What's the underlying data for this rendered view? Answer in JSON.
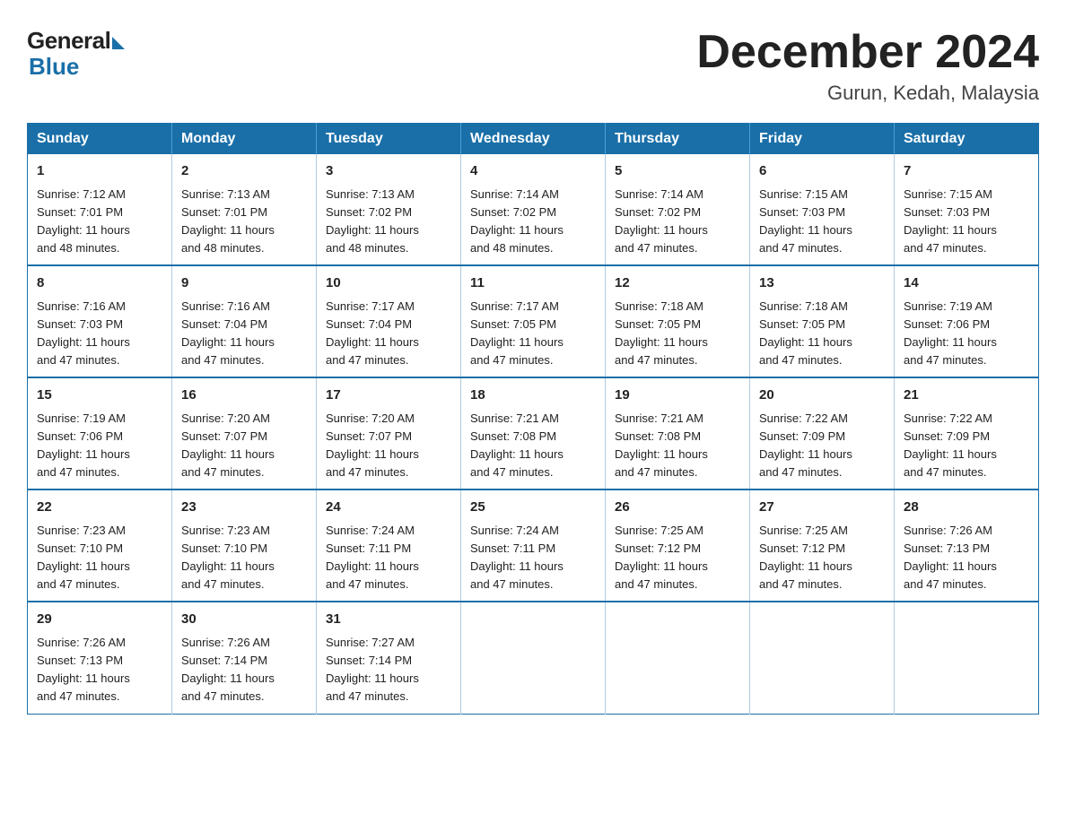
{
  "logo": {
    "general": "General",
    "blue": "Blue"
  },
  "title": {
    "month_year": "December 2024",
    "location": "Gurun, Kedah, Malaysia"
  },
  "weekdays": [
    "Sunday",
    "Monday",
    "Tuesday",
    "Wednesday",
    "Thursday",
    "Friday",
    "Saturday"
  ],
  "weeks": [
    [
      {
        "day": "1",
        "sunrise": "7:12 AM",
        "sunset": "7:01 PM",
        "daylight": "11 hours and 48 minutes."
      },
      {
        "day": "2",
        "sunrise": "7:13 AM",
        "sunset": "7:01 PM",
        "daylight": "11 hours and 48 minutes."
      },
      {
        "day": "3",
        "sunrise": "7:13 AM",
        "sunset": "7:02 PM",
        "daylight": "11 hours and 48 minutes."
      },
      {
        "day": "4",
        "sunrise": "7:14 AM",
        "sunset": "7:02 PM",
        "daylight": "11 hours and 48 minutes."
      },
      {
        "day": "5",
        "sunrise": "7:14 AM",
        "sunset": "7:02 PM",
        "daylight": "11 hours and 47 minutes."
      },
      {
        "day": "6",
        "sunrise": "7:15 AM",
        "sunset": "7:03 PM",
        "daylight": "11 hours and 47 minutes."
      },
      {
        "day": "7",
        "sunrise": "7:15 AM",
        "sunset": "7:03 PM",
        "daylight": "11 hours and 47 minutes."
      }
    ],
    [
      {
        "day": "8",
        "sunrise": "7:16 AM",
        "sunset": "7:03 PM",
        "daylight": "11 hours and 47 minutes."
      },
      {
        "day": "9",
        "sunrise": "7:16 AM",
        "sunset": "7:04 PM",
        "daylight": "11 hours and 47 minutes."
      },
      {
        "day": "10",
        "sunrise": "7:17 AM",
        "sunset": "7:04 PM",
        "daylight": "11 hours and 47 minutes."
      },
      {
        "day": "11",
        "sunrise": "7:17 AM",
        "sunset": "7:05 PM",
        "daylight": "11 hours and 47 minutes."
      },
      {
        "day": "12",
        "sunrise": "7:18 AM",
        "sunset": "7:05 PM",
        "daylight": "11 hours and 47 minutes."
      },
      {
        "day": "13",
        "sunrise": "7:18 AM",
        "sunset": "7:05 PM",
        "daylight": "11 hours and 47 minutes."
      },
      {
        "day": "14",
        "sunrise": "7:19 AM",
        "sunset": "7:06 PM",
        "daylight": "11 hours and 47 minutes."
      }
    ],
    [
      {
        "day": "15",
        "sunrise": "7:19 AM",
        "sunset": "7:06 PM",
        "daylight": "11 hours and 47 minutes."
      },
      {
        "day": "16",
        "sunrise": "7:20 AM",
        "sunset": "7:07 PM",
        "daylight": "11 hours and 47 minutes."
      },
      {
        "day": "17",
        "sunrise": "7:20 AM",
        "sunset": "7:07 PM",
        "daylight": "11 hours and 47 minutes."
      },
      {
        "day": "18",
        "sunrise": "7:21 AM",
        "sunset": "7:08 PM",
        "daylight": "11 hours and 47 minutes."
      },
      {
        "day": "19",
        "sunrise": "7:21 AM",
        "sunset": "7:08 PM",
        "daylight": "11 hours and 47 minutes."
      },
      {
        "day": "20",
        "sunrise": "7:22 AM",
        "sunset": "7:09 PM",
        "daylight": "11 hours and 47 minutes."
      },
      {
        "day": "21",
        "sunrise": "7:22 AM",
        "sunset": "7:09 PM",
        "daylight": "11 hours and 47 minutes."
      }
    ],
    [
      {
        "day": "22",
        "sunrise": "7:23 AM",
        "sunset": "7:10 PM",
        "daylight": "11 hours and 47 minutes."
      },
      {
        "day": "23",
        "sunrise": "7:23 AM",
        "sunset": "7:10 PM",
        "daylight": "11 hours and 47 minutes."
      },
      {
        "day": "24",
        "sunrise": "7:24 AM",
        "sunset": "7:11 PM",
        "daylight": "11 hours and 47 minutes."
      },
      {
        "day": "25",
        "sunrise": "7:24 AM",
        "sunset": "7:11 PM",
        "daylight": "11 hours and 47 minutes."
      },
      {
        "day": "26",
        "sunrise": "7:25 AM",
        "sunset": "7:12 PM",
        "daylight": "11 hours and 47 minutes."
      },
      {
        "day": "27",
        "sunrise": "7:25 AM",
        "sunset": "7:12 PM",
        "daylight": "11 hours and 47 minutes."
      },
      {
        "day": "28",
        "sunrise": "7:26 AM",
        "sunset": "7:13 PM",
        "daylight": "11 hours and 47 minutes."
      }
    ],
    [
      {
        "day": "29",
        "sunrise": "7:26 AM",
        "sunset": "7:13 PM",
        "daylight": "11 hours and 47 minutes."
      },
      {
        "day": "30",
        "sunrise": "7:26 AM",
        "sunset": "7:14 PM",
        "daylight": "11 hours and 47 minutes."
      },
      {
        "day": "31",
        "sunrise": "7:27 AM",
        "sunset": "7:14 PM",
        "daylight": "11 hours and 47 minutes."
      },
      null,
      null,
      null,
      null
    ]
  ],
  "labels": {
    "sunrise": "Sunrise:",
    "sunset": "Sunset:",
    "daylight": "Daylight:"
  }
}
